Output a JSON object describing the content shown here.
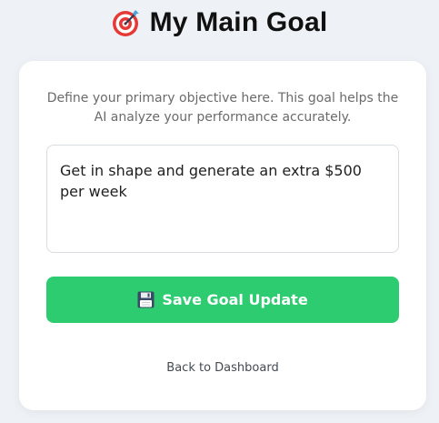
{
  "header": {
    "icon": "target-icon",
    "title": "My Main Goal"
  },
  "card": {
    "description": "Define your primary objective here. This goal helps the AI analyze your performance accurately.",
    "goal_value": "Get in shape and generate an extra $500 per week",
    "save_icon": "floppy-disk-icon",
    "save_label": "Save Goal Update",
    "back_link": "Back to Dashboard"
  },
  "colors": {
    "background": "#eef1f6",
    "card": "#ffffff",
    "accent_green": "#2ecc71",
    "target_red": "#e53935"
  }
}
